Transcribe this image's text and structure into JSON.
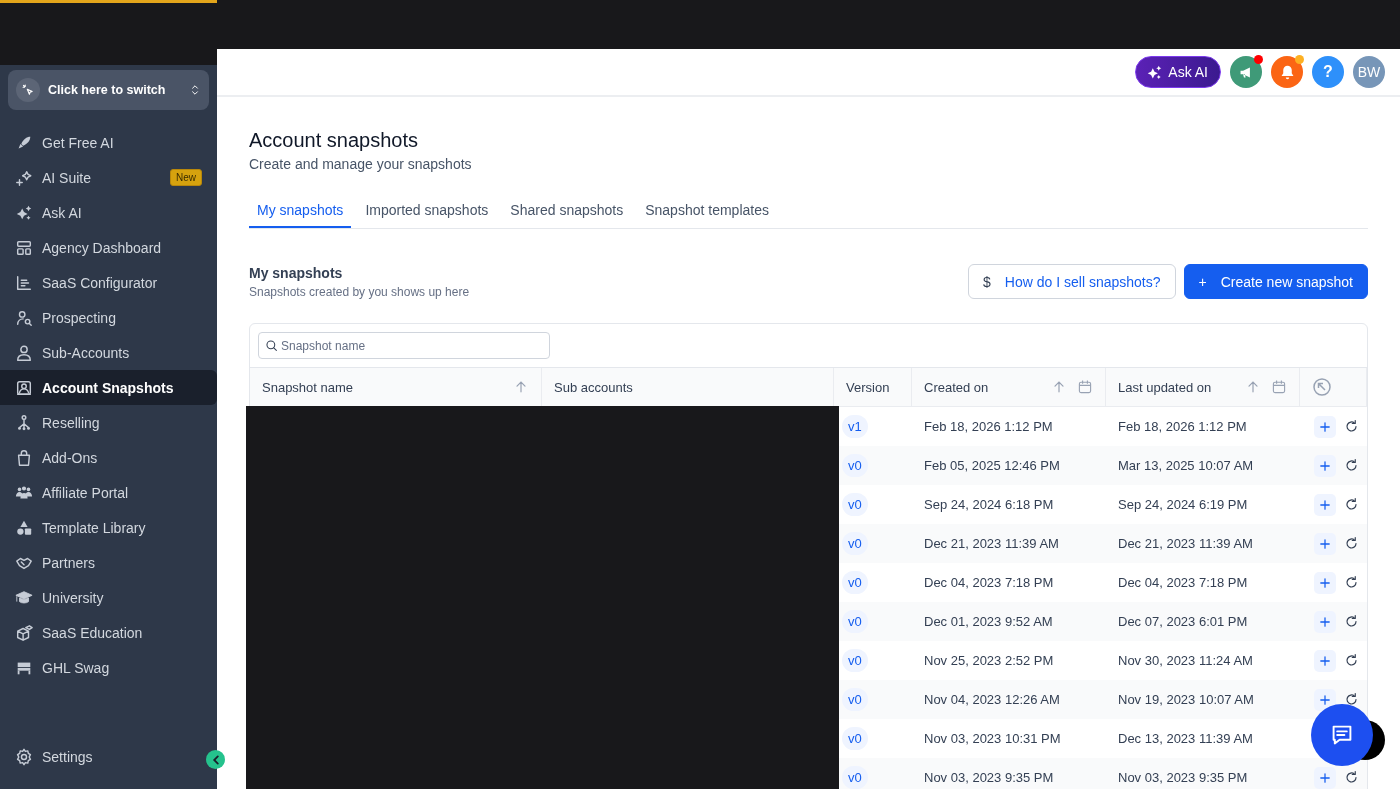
{
  "sidebar": {
    "switcher": {
      "label": "Click here to switch"
    },
    "items": [
      {
        "label": "Get Free AI",
        "selected": false
      },
      {
        "label": "AI Suite",
        "badge": "New",
        "selected": false
      },
      {
        "label": "Ask AI",
        "selected": false
      },
      {
        "label": "Agency Dashboard",
        "selected": false
      },
      {
        "label": "SaaS Configurator",
        "selected": false
      },
      {
        "label": "Prospecting",
        "selected": false
      },
      {
        "label": "Sub-Accounts",
        "selected": false
      },
      {
        "label": "Account Snapshots",
        "selected": true
      },
      {
        "label": "Reselling",
        "selected": false
      },
      {
        "label": "Add-Ons",
        "selected": false
      },
      {
        "label": "Affiliate Portal",
        "selected": false
      },
      {
        "label": "Template Library",
        "selected": false
      },
      {
        "label": "Partners",
        "selected": false
      },
      {
        "label": "University",
        "selected": false
      },
      {
        "label": "SaaS Education",
        "selected": false
      },
      {
        "label": "GHL Swag",
        "selected": false
      }
    ],
    "settings": {
      "label": "Settings"
    }
  },
  "header": {
    "ask_ai": "Ask AI",
    "announcements": {
      "unread": true
    },
    "notifications": {
      "unread": true
    },
    "help": "?",
    "avatar": "BW"
  },
  "page": {
    "title": "Account snapshots",
    "subtitle": "Create and manage your snapshots",
    "tabs": [
      {
        "label": "My snapshots",
        "selected": true
      },
      {
        "label": "Imported snapshots",
        "selected": false
      },
      {
        "label": "Shared snapshots",
        "selected": false
      },
      {
        "label": "Snapshot templates",
        "selected": false
      }
    ]
  },
  "section": {
    "title": "My snapshots",
    "subtitle": "Snapshots created by you shows up here",
    "buttons": [
      {
        "kind": "secondary",
        "symbol": "$",
        "label": "How do I sell snapshots?"
      },
      {
        "kind": "primary",
        "symbol": "+",
        "label": "Create new snapshot"
      }
    ]
  },
  "table": {
    "search": {
      "placeholder": "Snapshot name"
    },
    "columns": [
      {
        "label": "Snapshot name",
        "sortable": true,
        "date_filter": false
      },
      {
        "label": "Sub accounts",
        "sortable": false,
        "date_filter": false
      },
      {
        "label": "Version",
        "sortable": false,
        "date_filter": false
      },
      {
        "label": "Created on",
        "sortable": true,
        "date_filter": true
      },
      {
        "label": "Last updated on",
        "sortable": true,
        "date_filter": true
      }
    ],
    "rows": [
      {
        "version": "v1",
        "created_on": "Feb 18, 2026 1:12 PM",
        "last_updated_on": "Feb 18, 2026 1:12 PM"
      },
      {
        "version": "v0",
        "created_on": "Feb 05, 2025 12:46 PM",
        "last_updated_on": "Mar 13, 2025 10:07 AM"
      },
      {
        "version": "v0",
        "created_on": "Sep 24, 2024 6:18 PM",
        "last_updated_on": "Sep 24, 2024 6:19 PM"
      },
      {
        "version": "v0",
        "created_on": "Dec 21, 2023 11:39 AM",
        "last_updated_on": "Dec 21, 2023 11:39 AM"
      },
      {
        "version": "v0",
        "created_on": "Dec 04, 2023 7:18 PM",
        "last_updated_on": "Dec 04, 2023 7:18 PM"
      },
      {
        "version": "v0",
        "created_on": "Dec 01, 2023 9:52 AM",
        "last_updated_on": "Dec 07, 2023 6:01 PM"
      },
      {
        "version": "v0",
        "created_on": "Nov 25, 2023 2:52 PM",
        "last_updated_on": "Nov 30, 2023 11:24 AM"
      },
      {
        "version": "v0",
        "created_on": "Nov 04, 2023 12:26 AM",
        "last_updated_on": "Nov 19, 2023 10:07 AM"
      },
      {
        "version": "v0",
        "created_on": "Nov 03, 2023 10:31 PM",
        "last_updated_on": "Dec 13, 2023 11:39 AM",
        "actions": false
      },
      {
        "version": "v0",
        "created_on": "Nov 03, 2023 9:35 PM",
        "last_updated_on": "Nov 03, 2023 9:35 PM"
      }
    ]
  }
}
